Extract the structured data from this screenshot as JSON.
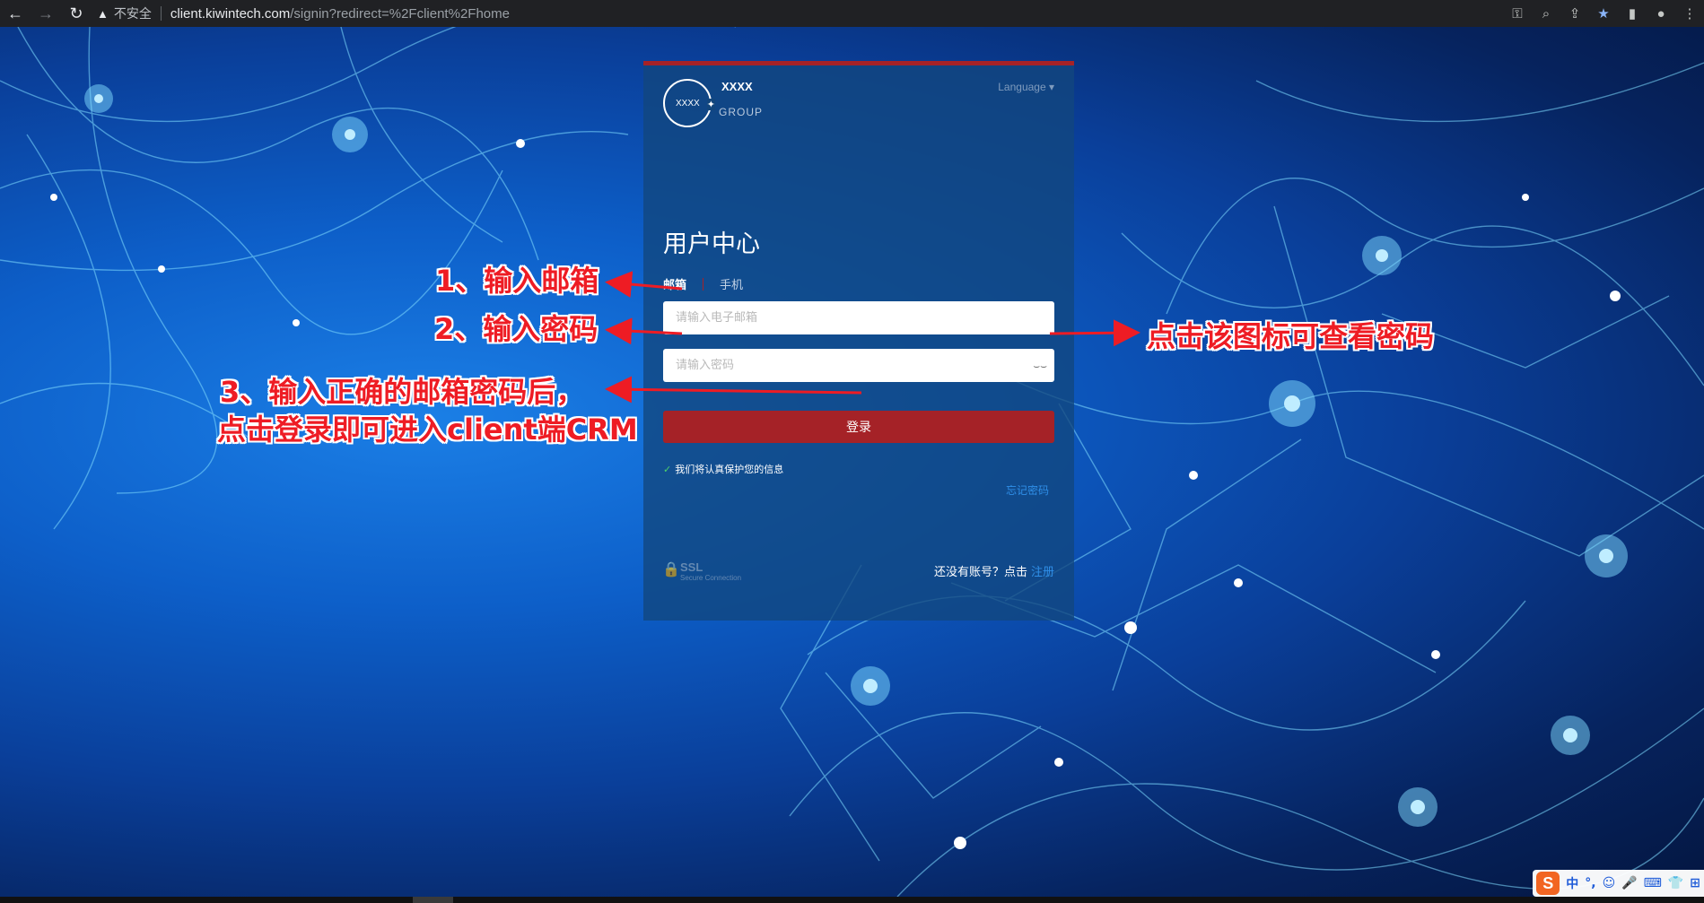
{
  "browser": {
    "warning_label": "不安全",
    "url_host": "client.kiwintech.com",
    "url_path": "/signin?redirect=%2Fclient%2Fhome"
  },
  "brand": {
    "logo_text": "XXXX",
    "name": "XXXX",
    "group": "GROUP"
  },
  "language_label": "Language ▾",
  "heading": "用户中心",
  "tabs": {
    "email": "邮箱",
    "phone": "手机"
  },
  "email_placeholder": "请输入电子邮箱",
  "password_placeholder": "请输入密码",
  "password_toggle_icon": "eye-closed-icon",
  "login_button": "登录",
  "protect_text": "我们将认真保护您的信息",
  "forgot_link": "忘记密码",
  "ssl": {
    "title": "SSL",
    "subtitle": "Secure Connection"
  },
  "signup": {
    "prompt": "还没有账号？点击",
    "link": "注册"
  },
  "annotations": {
    "step1": "1、输入邮箱",
    "step2": "2、输入密码",
    "step3_line1": "3、输入正确的邮箱密码后，",
    "step3_line2": "点击登录即可进入client端CRM",
    "eye_hint": "点击该图标可查看密码"
  },
  "colors": {
    "accent_red": "#a52227",
    "link_blue": "#2f8fe8",
    "annotation_red": "#ee1c24"
  },
  "ime": {
    "items": [
      "中",
      "°,",
      "☺",
      "🎤",
      "⌨",
      "👕",
      "⊞"
    ]
  }
}
